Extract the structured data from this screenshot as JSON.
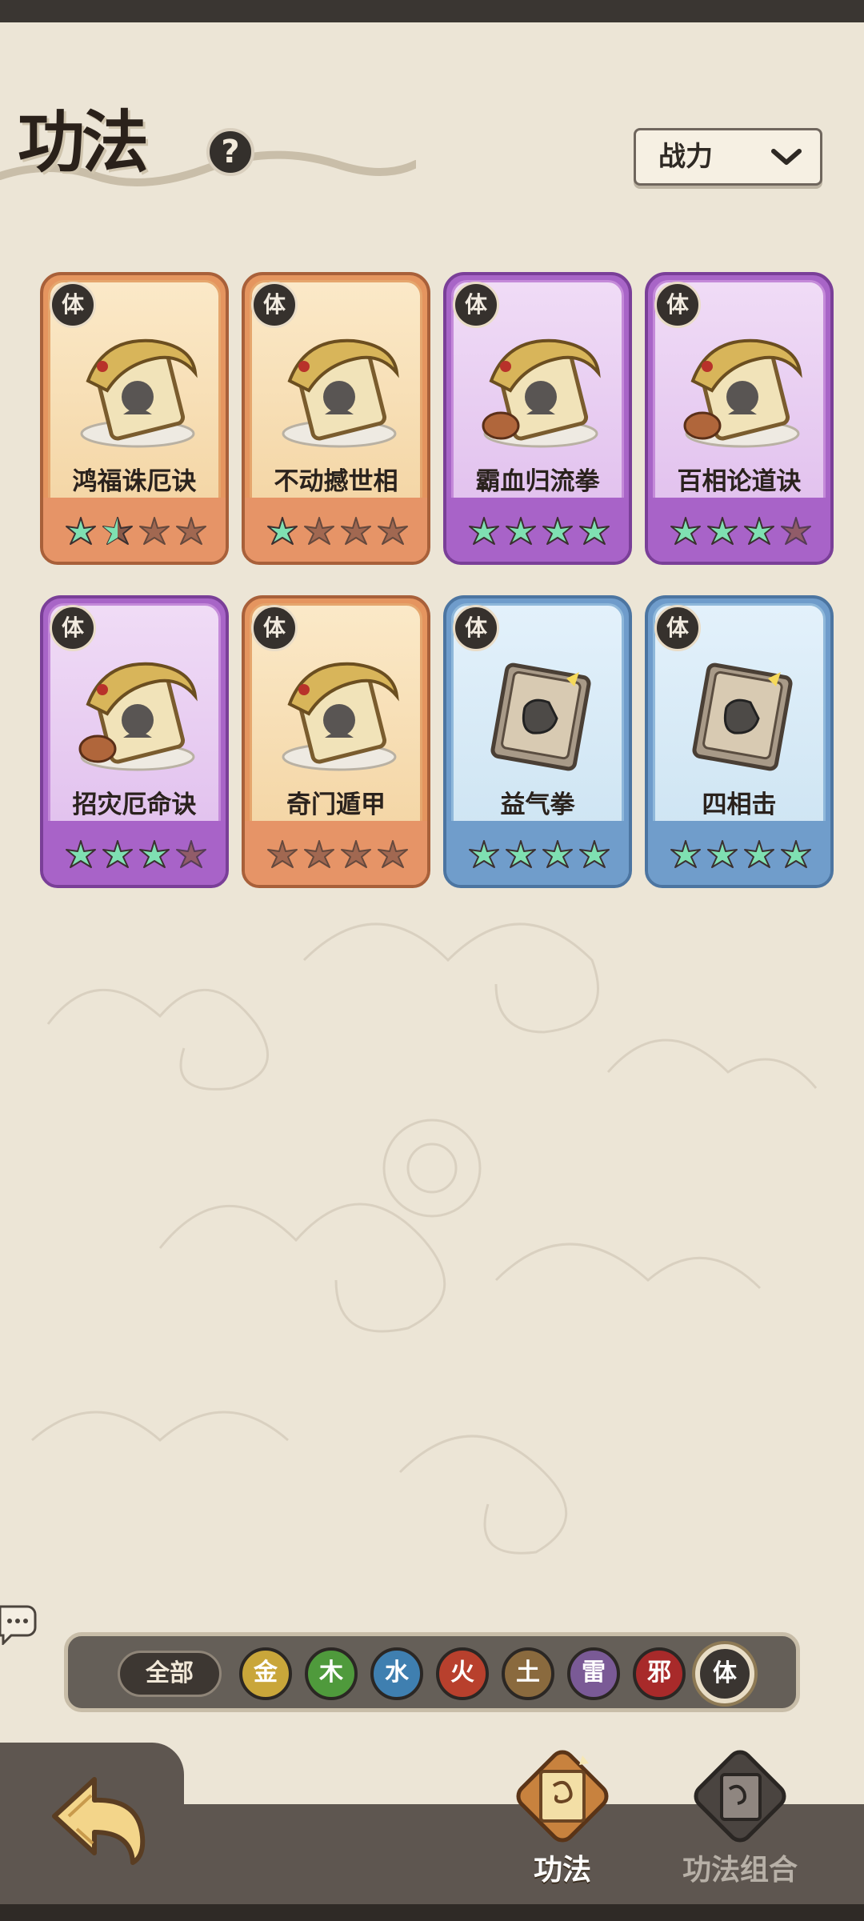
{
  "header": {
    "title": "功法",
    "help": "?",
    "sort": {
      "label": "战力"
    }
  },
  "cards": [
    {
      "name": "鸿福诛厄诀",
      "badge": "体",
      "rarity": "orange",
      "stars_lit": 1.5,
      "icon": "dragon-scroll-figure-icon"
    },
    {
      "name": "不动撼世相",
      "badge": "体",
      "rarity": "orange",
      "stars_lit": 1,
      "icon": "dragon-scroll-buddha-icon"
    },
    {
      "name": "霸血归流拳",
      "badge": "体",
      "rarity": "purple",
      "stars_lit": 4,
      "icon": "dragon-scroll-fist-icon"
    },
    {
      "name": "百相论道诀",
      "badge": "体",
      "rarity": "purple",
      "stars_lit": 3,
      "icon": "dragon-scroll-palm-icon"
    },
    {
      "name": "招灾厄命诀",
      "badge": "体",
      "rarity": "purple",
      "stars_lit": 3,
      "icon": "dragon-scroll-arrow-icon"
    },
    {
      "name": "奇门遁甲",
      "badge": "体",
      "rarity": "orange",
      "stars_lit": 0,
      "icon": "dragon-scroll-burst-icon"
    },
    {
      "name": "益气拳",
      "badge": "体",
      "rarity": "blue",
      "stars_lit": 4,
      "icon": "book-fist-icon"
    },
    {
      "name": "四相击",
      "badge": "体",
      "rarity": "blue",
      "stars_lit": 4,
      "icon": "book-palm-icon"
    }
  ],
  "filters": {
    "all": "全部",
    "elements": [
      {
        "label": "金",
        "color": "#c9a63a"
      },
      {
        "label": "木",
        "color": "#4f9a3c"
      },
      {
        "label": "水",
        "color": "#3f7fb0"
      },
      {
        "label": "火",
        "color": "#b8402d"
      },
      {
        "label": "土",
        "color": "#8a6a3e"
      },
      {
        "label": "雷",
        "color": "#7a5a96"
      },
      {
        "label": "邪",
        "color": "#a82a2a"
      },
      {
        "label": "体",
        "color": "#3a3531",
        "selected": true
      }
    ]
  },
  "bottom_nav": {
    "tabs": [
      {
        "label": "功法",
        "active": true
      },
      {
        "label": "功法组合",
        "active": false
      }
    ]
  },
  "colors": {
    "orange": "#e5955f",
    "purple": "#a865c7",
    "blue": "#6f9ccb",
    "star_lit": "#7fe0b2",
    "star_dim": "#8a5a4a"
  }
}
